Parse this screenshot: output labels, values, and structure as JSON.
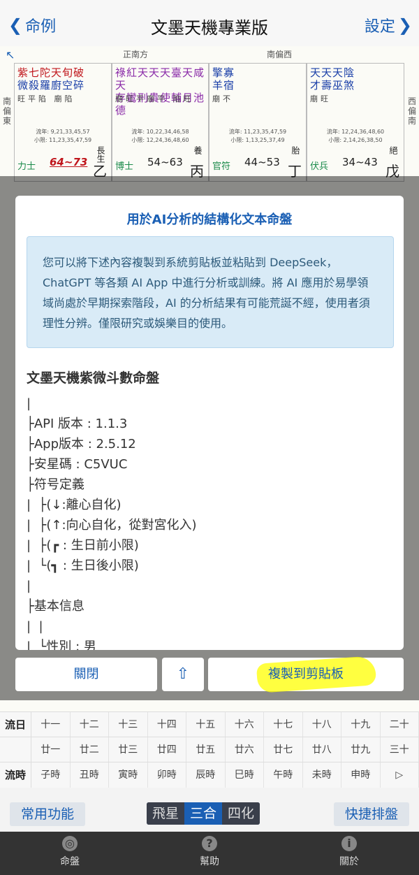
{
  "navbar": {
    "back_label": "命例",
    "title": "文墨天機專業版",
    "settings_label": "設定"
  },
  "chart": {
    "directions": {
      "south": "正南方",
      "south_west": "南偏西",
      "east_side": "南偏東",
      "west_side": "西偏南"
    },
    "palaces": [
      {
        "stars_line1": "紫七陀天旬破",
        "stars_line2": "微殺羅廚空碎",
        "brightness": "旺平陷 廟陷",
        "liunian": "流年: 9,21,33,45,57",
        "xiaoxian": "小限: 11,23,35,47,59",
        "god": "力士",
        "age": "64~73",
        "stage": "長生",
        "stem": "乙"
      },
      {
        "stars_line1": "祿紅天天天臺天咸天",
        "stars_line2": "存鸞刑貴使輔月池德",
        "brightness": "廟旺平廟平 陷旺",
        "liunian": "流年: 10,22,34,46,58",
        "xiaoxian": "小限: 12,24,36,48,60",
        "god": "博士",
        "age": "54~63",
        "stage": "養",
        "stem": "丙"
      },
      {
        "stars_line1": "擎寡",
        "stars_line2": "羊宿",
        "brightness": "廟不",
        "liunian": "流年: 11,23,35,47,59",
        "xiaoxian": "小限: 1,13,25,37,49",
        "god": "官符",
        "age": "44~53",
        "stage": "胎",
        "stem": "丁"
      },
      {
        "stars_line1": "天天天陰",
        "stars_line2": "才壽巫煞",
        "brightness": "廟旺",
        "liunian": "流年: 12,24,36,48,60",
        "xiaoxian": "小限: 2,14,26,38,50",
        "god": "伏兵",
        "age": "34~43",
        "stage": "絕",
        "stem": "戊"
      }
    ],
    "date_grid": {
      "row_day_label": "流日",
      "row_day_1": [
        "十一",
        "十二",
        "十三",
        "十四",
        "十五",
        "十六",
        "十七",
        "十八",
        "十九",
        "二十"
      ],
      "row_day_2": [
        "廿一",
        "廿二",
        "廿三",
        "廿四",
        "廿五",
        "廿六",
        "廿七",
        "廿八",
        "廿九",
        "三十"
      ],
      "row_hour_label": "流時",
      "row_hour": [
        "子時",
        "丑時",
        "寅時",
        "卯時",
        "辰時",
        "巳時",
        "午時",
        "未時",
        "申時",
        "▷"
      ]
    }
  },
  "dialog": {
    "title": "用於AI分析的結構化文本命盤",
    "notice": "您可以將下述內容複製到系統剪貼板並粘貼到 DeepSeek，ChatGPT 等各類 AI App 中進行分析或訓練。將 AI 應用於易學領域尚處於早期探索階段，AI 的分析結果有可能荒誕不經，使用者須理性分辨。僅限研究或娛樂目的使用。",
    "heading": "文墨天機紫微斗數命盤",
    "lines": [
      "|",
      "├API 版本 : 1.1.3",
      "├App版本 : 2.5.12",
      "├安星碼 : C5VUC",
      "├符号定義",
      "|  ├(↓:離心自化)",
      "|  ├(↑:向心自化，從對宮化入)",
      "|  ├(┏ : 生日前小限)",
      "|  └(┓ : 生日後小限)",
      "|",
      "├基本信息",
      "|  |",
      "|  └性別 : 男"
    ],
    "close_label": "關閉",
    "up_icon": "⇧",
    "copy_label": "複製到剪貼板"
  },
  "toolbar": {
    "left_label": "常用功能",
    "seg": [
      "飛星",
      "三合",
      "四化"
    ],
    "seg_active": 1,
    "right_label": "快捷排盤"
  },
  "tabbar": {
    "tabs": [
      {
        "label": "命盤",
        "icon": "◎"
      },
      {
        "label": "幫助",
        "icon": "?"
      },
      {
        "label": "關於",
        "icon": "i"
      }
    ]
  }
}
